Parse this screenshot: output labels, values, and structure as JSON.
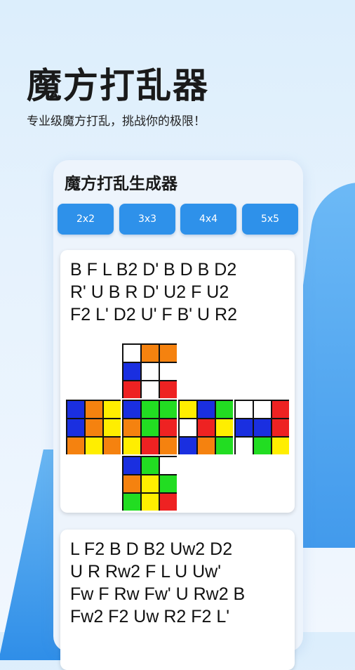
{
  "hero": {
    "title": "魔方打乱器",
    "subtitle": "专业级魔方打乱，挑战你的极限！"
  },
  "panel": {
    "title": "魔方打乱生成器",
    "sizes": [
      "2x2",
      "3x3",
      "4x4",
      "5x5"
    ]
  },
  "cards": [
    {
      "scramble_lines": [
        "B F L B2 D' B D B D2",
        "R' U B R D' U2 F U2",
        "F2 L' D2 U' F B' U R2"
      ],
      "net": {
        "colors": {
          "W": "#ffffff",
          "Y": "#ffee00",
          "R": "#ee2222",
          "O": "#f5820f",
          "B": "#1a2fe0",
          "G": "#22dd22"
        },
        "U": [
          "W",
          "O",
          "O",
          "B",
          "W",
          "W",
          "R",
          "W",
          "R"
        ],
        "L": [
          "B",
          "O",
          "Y",
          "B",
          "O",
          "Y",
          "O",
          "Y",
          "O"
        ],
        "F": [
          "B",
          "G",
          "G",
          "O",
          "G",
          "R",
          "Y",
          "R",
          "O"
        ],
        "R": [
          "Y",
          "B",
          "G",
          "W",
          "R",
          "Y",
          "B",
          "O",
          "G"
        ],
        "Bk": [
          "W",
          "W",
          "R",
          "B",
          "B",
          "R",
          "W",
          "G",
          "Y"
        ],
        "D": [
          "B",
          "G",
          "W",
          "O",
          "Y",
          "G",
          "G",
          "Y",
          "R"
        ]
      }
    },
    {
      "scramble_lines": [
        "L F2 B D B2 Uw2 D2",
        "U R Rw2 F L U Uw'",
        "Fw F Rw Fw' U Rw2 B",
        "Fw2 F2 Uw R2 F2 L'"
      ]
    }
  ]
}
